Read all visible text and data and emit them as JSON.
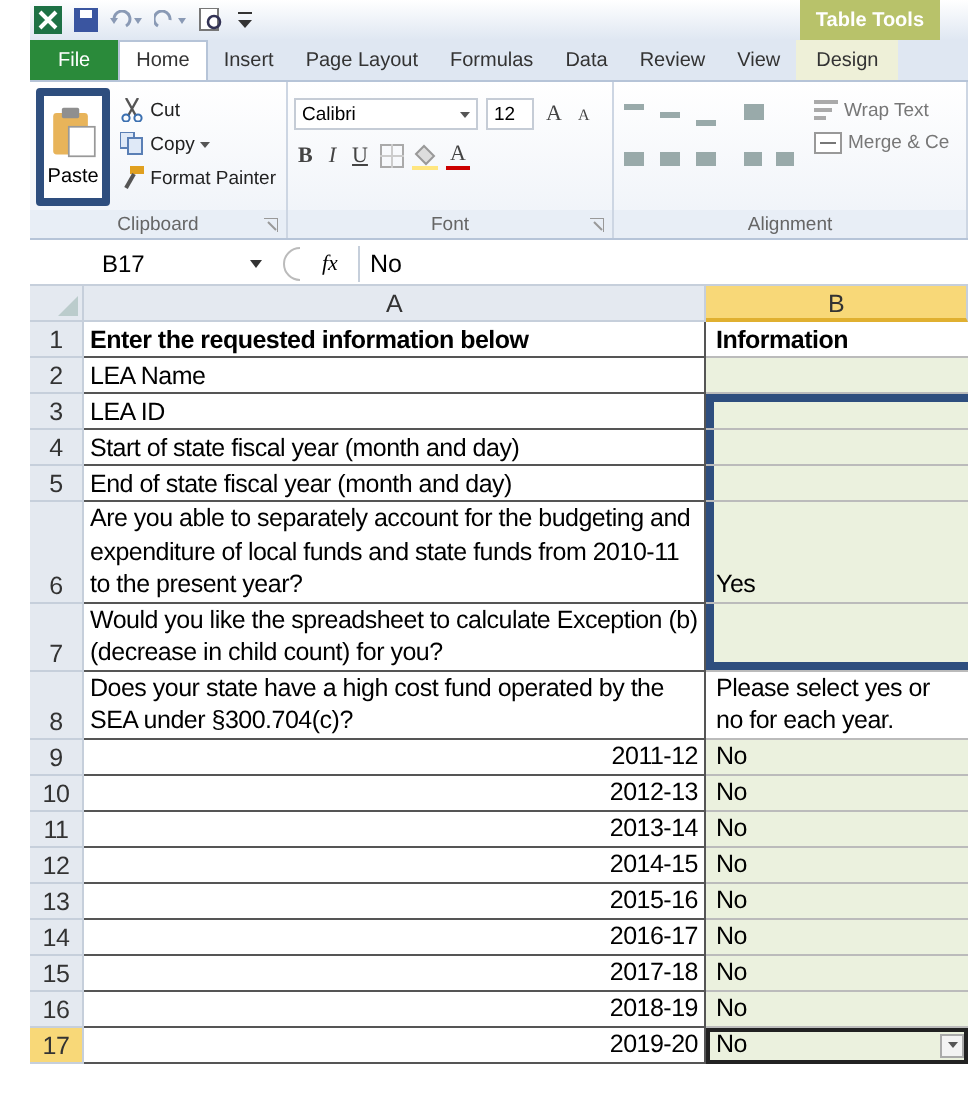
{
  "title_bar": {
    "contextual_title": "Table Tools"
  },
  "tabs": [
    {
      "label": "File",
      "kind": "file",
      "selected": false
    },
    {
      "label": "Home",
      "kind": "normal",
      "selected": true
    },
    {
      "label": "Insert",
      "kind": "normal",
      "selected": false
    },
    {
      "label": "Page Layout",
      "kind": "normal",
      "selected": false
    },
    {
      "label": "Formulas",
      "kind": "normal",
      "selected": false
    },
    {
      "label": "Data",
      "kind": "normal",
      "selected": false
    },
    {
      "label": "Review",
      "kind": "normal",
      "selected": false
    },
    {
      "label": "View",
      "kind": "normal",
      "selected": false
    },
    {
      "label": "Design",
      "kind": "contextual",
      "selected": false
    }
  ],
  "clipboard": {
    "paste": {
      "label": "Paste",
      "highlighted": true
    },
    "cut": "Cut",
    "copy": "Copy",
    "format_painter": "Format Painter",
    "group_label": "Clipboard"
  },
  "font": {
    "font_name": "Calibri",
    "font_size": "12",
    "grow": "A",
    "shrink": "A",
    "bold": "B",
    "italic": "I",
    "underline": "U",
    "font_color": "A",
    "group_label": "Font"
  },
  "alignment": {
    "wrap_text": "Wrap Text",
    "merge": "Merge & Ce",
    "group_label": "Alignment"
  },
  "formula_bar": {
    "name_box": "B17",
    "fx": "fx",
    "value": "No"
  },
  "columns": [
    {
      "label": "A",
      "selected": false
    },
    {
      "label": "B",
      "selected": true
    }
  ],
  "rows": [
    {
      "number": "1",
      "a": "Enter the requested information below",
      "kind": "label",
      "b": "Information",
      "bold": true,
      "input": false,
      "outlined": false,
      "selected": false
    },
    {
      "number": "2",
      "a": "LEA Name",
      "kind": "label",
      "b": "",
      "bold": false,
      "input": true,
      "outlined": false,
      "selected": false
    },
    {
      "number": "3",
      "a": "LEA ID",
      "kind": "label",
      "b": "",
      "bold": false,
      "input": true,
      "outlined": true,
      "selected": false
    },
    {
      "number": "4",
      "a": "Start of state fiscal year (month and day)",
      "kind": "label",
      "b": "",
      "bold": false,
      "input": true,
      "outlined": true,
      "selected": false
    },
    {
      "number": "5",
      "a": "End of state fiscal year (month and day)",
      "kind": "label",
      "b": "",
      "bold": false,
      "input": true,
      "outlined": true,
      "selected": false
    },
    {
      "number": "6",
      "a": "Are you able to separately account for the budgeting and expenditure of local funds and state funds from 2010-11 to the present year?",
      "kind": "label",
      "b": "Yes",
      "bold": false,
      "input": true,
      "outlined": true,
      "selected": false
    },
    {
      "number": "7",
      "a": "Would you like the spreadsheet to calculate Exception (b) (decrease in child count) for you?",
      "kind": "label",
      "b": "",
      "bold": false,
      "input": true,
      "outlined": true,
      "selected": false
    },
    {
      "number": "8",
      "a": "Does your state have a high cost fund operated by the SEA under §300.704(c)?",
      "kind": "label",
      "b": "Please select yes or no for each year.",
      "bold": false,
      "input": false,
      "outlined": false,
      "selected": false
    },
    {
      "number": "9",
      "a": "2011-12",
      "kind": "year",
      "b": "No",
      "bold": false,
      "input": true,
      "outlined": false,
      "selected": false
    },
    {
      "number": "10",
      "a": "2012-13",
      "kind": "year",
      "b": "No",
      "bold": false,
      "input": true,
      "outlined": false,
      "selected": false
    },
    {
      "number": "11",
      "a": "2013-14",
      "kind": "year",
      "b": "No",
      "bold": false,
      "input": true,
      "outlined": false,
      "selected": false
    },
    {
      "number": "12",
      "a": "2014-15",
      "kind": "year",
      "b": "No",
      "bold": false,
      "input": true,
      "outlined": false,
      "selected": false
    },
    {
      "number": "13",
      "a": "2015-16",
      "kind": "year",
      "b": "No",
      "bold": false,
      "input": true,
      "outlined": false,
      "selected": false
    },
    {
      "number": "14",
      "a": "2016-17",
      "kind": "year",
      "b": "No",
      "bold": false,
      "input": true,
      "outlined": false,
      "selected": false
    },
    {
      "number": "15",
      "a": "2017-18",
      "kind": "year",
      "b": "No",
      "bold": false,
      "input": true,
      "outlined": false,
      "selected": false
    },
    {
      "number": "16",
      "a": "2018-19",
      "kind": "year",
      "b": "No",
      "bold": false,
      "input": true,
      "outlined": false,
      "selected": false
    },
    {
      "number": "17",
      "a": "2019-20",
      "kind": "year",
      "b": "No",
      "bold": false,
      "input": true,
      "outlined": false,
      "selected": true
    }
  ]
}
